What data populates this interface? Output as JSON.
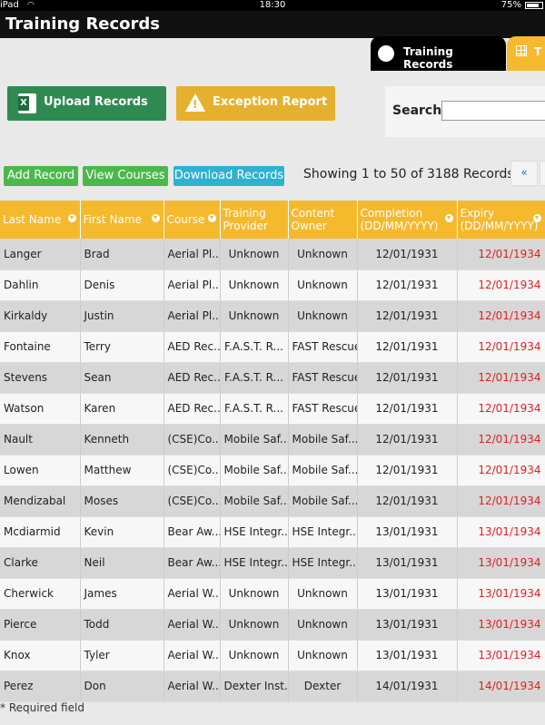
{
  "status": {
    "carrier": "iPad",
    "time": "18:30",
    "battery": "75%"
  },
  "app": {
    "title": "Training Records"
  },
  "tabs": [
    {
      "label": "Training Records",
      "active": true
    },
    {
      "label": "T",
      "active": false
    }
  ],
  "actions": {
    "upload": "Upload Records",
    "exception": "Exception Report"
  },
  "search": {
    "label": "Search:",
    "value": ""
  },
  "buttons": {
    "add": "Add Record",
    "courses": "View Courses",
    "download": "Download Records"
  },
  "summary": "Showing 1 to 50 of 3188 Records",
  "pager": {
    "first": "«"
  },
  "columns": [
    "Last Name",
    "First Name",
    "Course",
    "Training Provider",
    "Content Owner",
    "Completion (DD/MM/YYYY)",
    "Expiry (DD/MM/YYYY)"
  ],
  "rows": [
    [
      "Langer",
      "Brad",
      "Aerial Pl...",
      "Unknown",
      "Unknown",
      "12/01/1931",
      "12/01/1934"
    ],
    [
      "Dahlin",
      "Denis",
      "Aerial Pl...",
      "Unknown",
      "Unknown",
      "12/01/1931",
      "12/01/1934"
    ],
    [
      "Kirkaldy",
      "Justin",
      "Aerial Pl...",
      "Unknown",
      "Unknown",
      "12/01/1931",
      "12/01/1934"
    ],
    [
      "Fontaine",
      "Terry",
      "AED Rec...",
      "F.A.S.T. R...",
      "FAST Rescue",
      "12/01/1931",
      "12/01/1934"
    ],
    [
      "Stevens",
      "Sean",
      "AED Rec...",
      "F.A.S.T. R...",
      "FAST Rescue",
      "12/01/1931",
      "12/01/1934"
    ],
    [
      "Watson",
      "Karen",
      "AED Rec...",
      "F.A.S.T. R...",
      "FAST Rescue",
      "12/01/1931",
      "12/01/1934"
    ],
    [
      "Nault",
      "Kenneth",
      "(CSE)Co...",
      "Mobile Saf...",
      "Mobile Saf...",
      "12/01/1931",
      "12/01/1934"
    ],
    [
      "Lowen",
      "Matthew",
      "(CSE)Co...",
      "Mobile Saf...",
      "Mobile Saf...",
      "12/01/1931",
      "12/01/1934"
    ],
    [
      "Mendizabal",
      "Moses",
      "(CSE)Co...",
      "Mobile Saf...",
      "Mobile Saf...",
      "12/01/1931",
      "12/01/1934"
    ],
    [
      "Mcdiarmid",
      "Kevin",
      "Bear Aw...",
      "HSE Integr...",
      "HSE Integr...",
      "13/01/1931",
      "13/01/1934"
    ],
    [
      "Clarke",
      "Neil",
      "Bear Aw...",
      "HSE Integr...",
      "HSE Integr...",
      "13/01/1931",
      "13/01/1934"
    ],
    [
      "Cherwick",
      "James",
      "Aerial W...",
      "Unknown",
      "Unknown",
      "13/01/1931",
      "13/01/1934"
    ],
    [
      "Pierce",
      "Todd",
      "Aerial W...",
      "Unknown",
      "Unknown",
      "13/01/1931",
      "13/01/1934"
    ],
    [
      "Knox",
      "Tyler",
      "Aerial W...",
      "Unknown",
      "Unknown",
      "13/01/1931",
      "13/01/1934"
    ],
    [
      "Perez",
      "Don",
      "Aerial W...",
      "Dexter Inst...",
      "Dexter",
      "14/01/1931",
      "14/01/1934"
    ]
  ],
  "footer": "* Required field",
  "colors": {
    "accent": "#f5b92e",
    "upload": "#2f8a52",
    "exception": "#e6b02f",
    "add": "#4cb84c",
    "download": "#2fb2cf",
    "expiry": "#e02020"
  }
}
